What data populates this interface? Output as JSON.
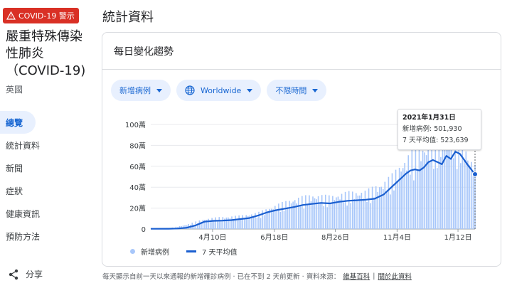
{
  "sidebar": {
    "alert_label": "COVID-19 警示",
    "disease_title": "嚴重特殊傳染性肺炎（COVID-19)",
    "region": "英國",
    "nav": [
      "總覽",
      "統計資料",
      "新聞",
      "症狀",
      "健康資訊",
      "預防方法"
    ],
    "active_nav": 0,
    "share_label": "分享"
  },
  "main": {
    "page_title": "統計資料",
    "card_title": "每日變化趨勢",
    "filters": [
      "新增病例",
      "Worldwide",
      "不限時間"
    ]
  },
  "tooltip": {
    "date": "2021年1月31日",
    "cases_label": "新增病例:",
    "cases_value": "501,930",
    "avg_label": "7 天平均值:",
    "avg_value": "523,639"
  },
  "legend": {
    "bars": "新增病例",
    "line": "7 天平均值"
  },
  "footer": {
    "text": "每天顯示自前一天以來通報的新增確診病例 · 已在不到 2 天前更新 · 資料來源：",
    "link1": "維基百科",
    "link2": "關於此資料"
  },
  "colors": {
    "bar": "#a8c7fa",
    "line": "#1a5fd0",
    "accent": "#1967d2",
    "alert": "#d93025"
  },
  "chart_data": {
    "type": "bar",
    "y_tick_labels": [
      "0",
      "20萬",
      "40萬",
      "60萬",
      "80萬",
      "100萬"
    ],
    "y_ticks": [
      0,
      200000,
      400000,
      600000,
      800000,
      1000000
    ],
    "ylim": [
      0,
      1000000
    ],
    "x_tick_labels": [
      "4月10日",
      "6月18日",
      "8月26日",
      "11月4日",
      "1月12日"
    ],
    "x_tick_positions": [
      69,
      138,
      206,
      275,
      343
    ],
    "x_range": [
      0,
      362
    ],
    "series": [
      {
        "name": "新增病例",
        "type": "bar",
        "x": [
          0,
          20,
          40,
          60,
          80,
          100,
          120,
          140,
          160,
          180,
          200,
          220,
          240,
          260,
          270,
          280,
          290,
          300,
          310,
          320,
          330,
          340,
          345,
          350,
          355,
          362
        ],
        "y": [
          2000,
          5000,
          35000,
          80000,
          95000,
          105000,
          130000,
          190000,
          240000,
          270000,
          260000,
          290000,
          300000,
          370000,
          430000,
          520000,
          600000,
          640000,
          680000,
          720000,
          760000,
          760000,
          740000,
          680000,
          580000,
          501930
        ]
      },
      {
        "name": "7 天平均值",
        "type": "line",
        "x": [
          0,
          20,
          30,
          40,
          50,
          60,
          70,
          80,
          90,
          100,
          110,
          120,
          130,
          140,
          150,
          160,
          170,
          180,
          190,
          200,
          210,
          220,
          230,
          240,
          250,
          260,
          265,
          270,
          275,
          280,
          285,
          290,
          295,
          300,
          305,
          310,
          315,
          320,
          325,
          330,
          335,
          340,
          345,
          350,
          355,
          362
        ],
        "y": [
          2000,
          2500,
          5000,
          12000,
          35000,
          70000,
          78000,
          80000,
          85000,
          95000,
          105000,
          130000,
          160000,
          180000,
          195000,
          210000,
          230000,
          240000,
          250000,
          245000,
          260000,
          270000,
          275000,
          280000,
          290000,
          330000,
          370000,
          410000,
          450000,
          490000,
          530000,
          560000,
          570000,
          560000,
          590000,
          640000,
          660000,
          640000,
          620000,
          700000,
          670000,
          740000,
          720000,
          660000,
          600000,
          523639
        ]
      }
    ]
  }
}
